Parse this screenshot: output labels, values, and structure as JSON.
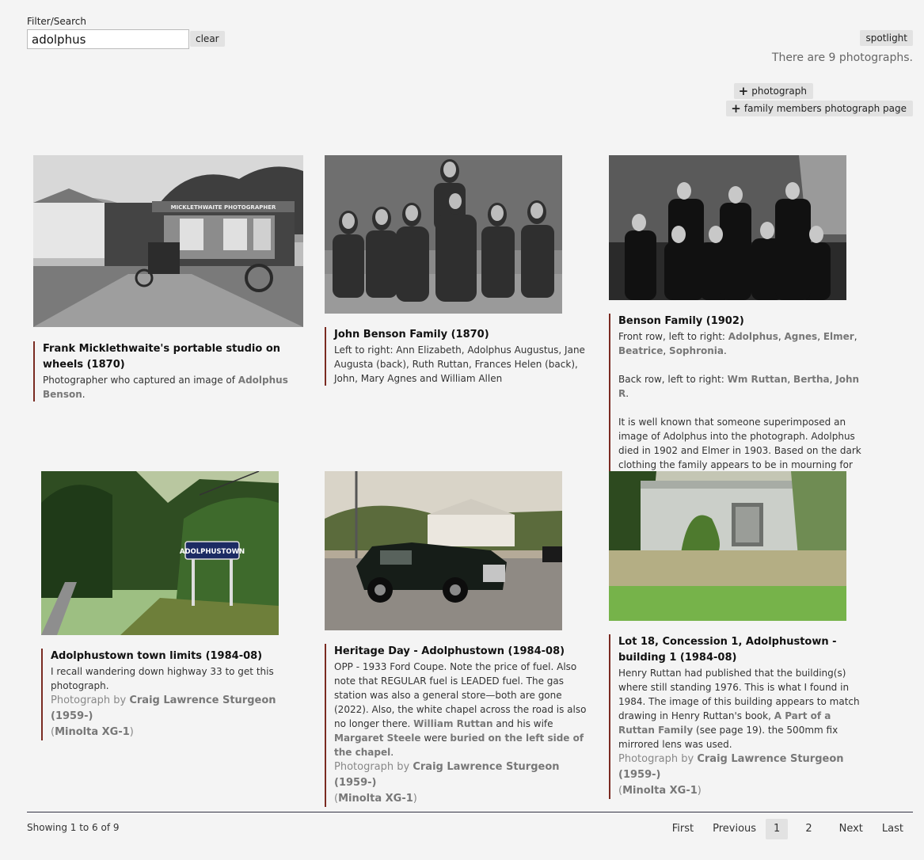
{
  "filter": {
    "label": "Filter/Search",
    "value": "adolphus",
    "clear_label": "clear"
  },
  "spotlight_label": "spotlight",
  "count_text": "There are 9 photographs.",
  "add_photograph_label": "photograph",
  "add_family_label": "family members photograph page",
  "cards": [
    {
      "title": "Frank Micklethwaite's portable studio on wheels (1870)",
      "desc_before": "Photographer who captured an image of ",
      "desc_link": "Adolphus Benson",
      "desc_after": ".",
      "sign_text": "MICKLETHWAITE PHOTOGRAPHER"
    },
    {
      "title": "John Benson Family (1870)",
      "desc": "Left to right: Ann Elizabeth, Adolphus Augustus, Jane Augusta (back), Ruth Ruttan, Frances Helen (back), John, Mary Agnes and William Allen"
    },
    {
      "title": "Benson Family (1902)",
      "front_prefix": "Front row, left to right: ",
      "front_links": [
        "Adolphus",
        "Agnes",
        "Elmer",
        "Beatrice",
        "Sophronia"
      ],
      "back_prefix": "Back row, left to right: ",
      "back_links": [
        "Wm Ruttan",
        "Bertha",
        "John R"
      ],
      "para": "It is well known that someone superimposed an image of Adolphus into the photograph. Adolphus died in 1902 and Elmer in 1903. Based on the dark clothing the family appears to be in mourning for Adolphus."
    },
    {
      "title": "Adolphustown town limits (1984-08)",
      "desc": "I recall wandering down highway 33 to get this photograph.",
      "credit_prefix": "Photograph by ",
      "credit_name": "Craig Lawrence Sturgeon (1959-)",
      "camera": "Minolta XG-1",
      "sign_text": "ADOLPHUSTOWN"
    },
    {
      "title": "Heritage Day - Adolphustown (1984-08)",
      "desc_a": "OPP - 1933 Ford Coupe. Note the price of fuel. Also note that REGULAR fuel is LEADED fuel. The gas station was also a general store—both are gone (2022). Also, the white chapel across the road is also no longer there. ",
      "link_a": "William Ruttan",
      "desc_b": " and his wife ",
      "link_b": "Margaret Steele",
      "desc_c": " were ",
      "link_c": "buried on the left side of the chapel",
      "desc_d": ".",
      "credit_prefix": "Photograph by ",
      "credit_name": "Craig Lawrence Sturgeon (1959-)",
      "camera": "Minolta XG-1"
    },
    {
      "title": "Lot 18, Concession 1, Adolphustown - building 1 (1984-08)",
      "desc_a": "Henry Ruttan had published that the building(s) where still standing 1976. This is what I found in 1984. The image of this building appears to match drawing in Henry Ruttan's book, ",
      "link_a": "A Part of a Ruttan Family",
      "desc_b": " (see page 19). the 500mm fix mirrored lens was used.",
      "credit_prefix": "Photograph by ",
      "credit_name": "Craig Lawrence Sturgeon (1959-)",
      "camera": "Minolta XG-1"
    }
  ],
  "footer": {
    "showing": "Showing 1 to 6 of 9",
    "pager": {
      "first": "First",
      "previous": "Previous",
      "page1": "1",
      "page2": "2",
      "next": "Next",
      "last": "Last"
    }
  }
}
